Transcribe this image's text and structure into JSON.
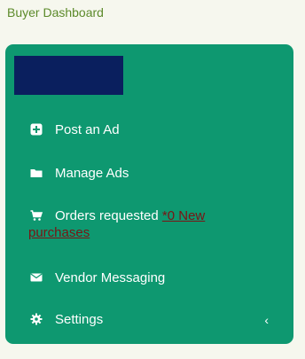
{
  "header": {
    "title": "Buyer Dashboard"
  },
  "colors": {
    "background": "#f6f7ee",
    "card": "#0e9870",
    "logo_block": "#0a1f5e",
    "title": "#5c8a2a",
    "new_link": "#7a1414"
  },
  "menu": {
    "post_ad": {
      "label": "Post an Ad",
      "icon": "plus-square-icon"
    },
    "manage_ads": {
      "label": "Manage Ads",
      "icon": "folder-icon"
    },
    "orders": {
      "label": "Orders requested",
      "link_part1": "*0 New",
      "link_part2": "purchases",
      "icon": "cart-icon"
    },
    "vendor_messaging": {
      "label": "Vendor Messaging",
      "icon": "envelope-icon"
    },
    "settings": {
      "label": "Settings",
      "icon": "gear-icon",
      "chevron": "‹"
    }
  }
}
